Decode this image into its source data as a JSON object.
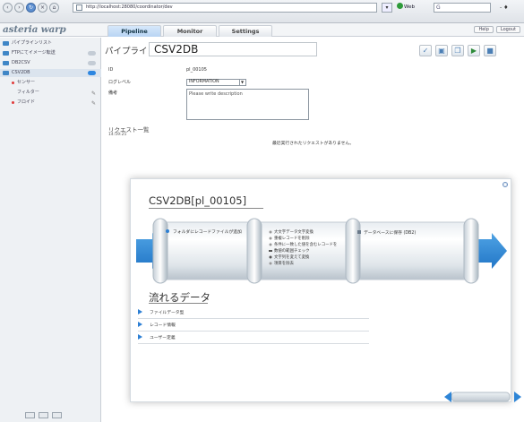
{
  "browser": {
    "url": "http://localhost:28080/coordinator/dev",
    "web_label": "Web",
    "search_value": "G"
  },
  "app": {
    "logo_main": "asteria",
    "logo_sub": "warp",
    "tabs": [
      {
        "label": "Pipeline"
      },
      {
        "label": "Monitor"
      },
      {
        "label": "Settings"
      }
    ],
    "help_label": "Help",
    "logout_label": "Logout"
  },
  "sidebar": {
    "items": [
      {
        "label": "パイプラインリスト"
      },
      {
        "label": "FTPにてイメージ転送"
      },
      {
        "label": "DB2CSV"
      },
      {
        "label": "CSV2DB"
      },
      {
        "label": "センサー"
      },
      {
        "label": "フィルター"
      },
      {
        "label": "フロイド"
      }
    ]
  },
  "pipeline": {
    "name_label": "パイプライン名",
    "name_value": "CSV2DB",
    "id_label": "ID",
    "id_value": "pl_00105",
    "loglevel_label": "ログレベル",
    "loglevel_value": "INFORMATION",
    "memo_label": "備考",
    "memo_placeholder": "Please write description",
    "request_list_label": "リクエスト一覧",
    "request_time": "14:59:25",
    "no_requests_text": "最近実行されたリクエストがありません。"
  },
  "diagram": {
    "title": "CSV2DB[pl_00105]",
    "pipe_steps": {
      "input": "フォルダにレコードファイルが追加",
      "transforms": [
        "大文字データ文字変換",
        "重複レコードを削除",
        "条件に一致した値を含むレコードを",
        "数値の範囲チェック",
        "文字列を変えて変換",
        "項目を除去"
      ],
      "output": "データベースに保存 (DB2)"
    },
    "flow_title": "流れるデータ",
    "flow_rows": [
      {
        "label": "ファイルデータ型"
      },
      {
        "label": "レコード情報"
      },
      {
        "label": "ユーザー定義"
      }
    ]
  }
}
